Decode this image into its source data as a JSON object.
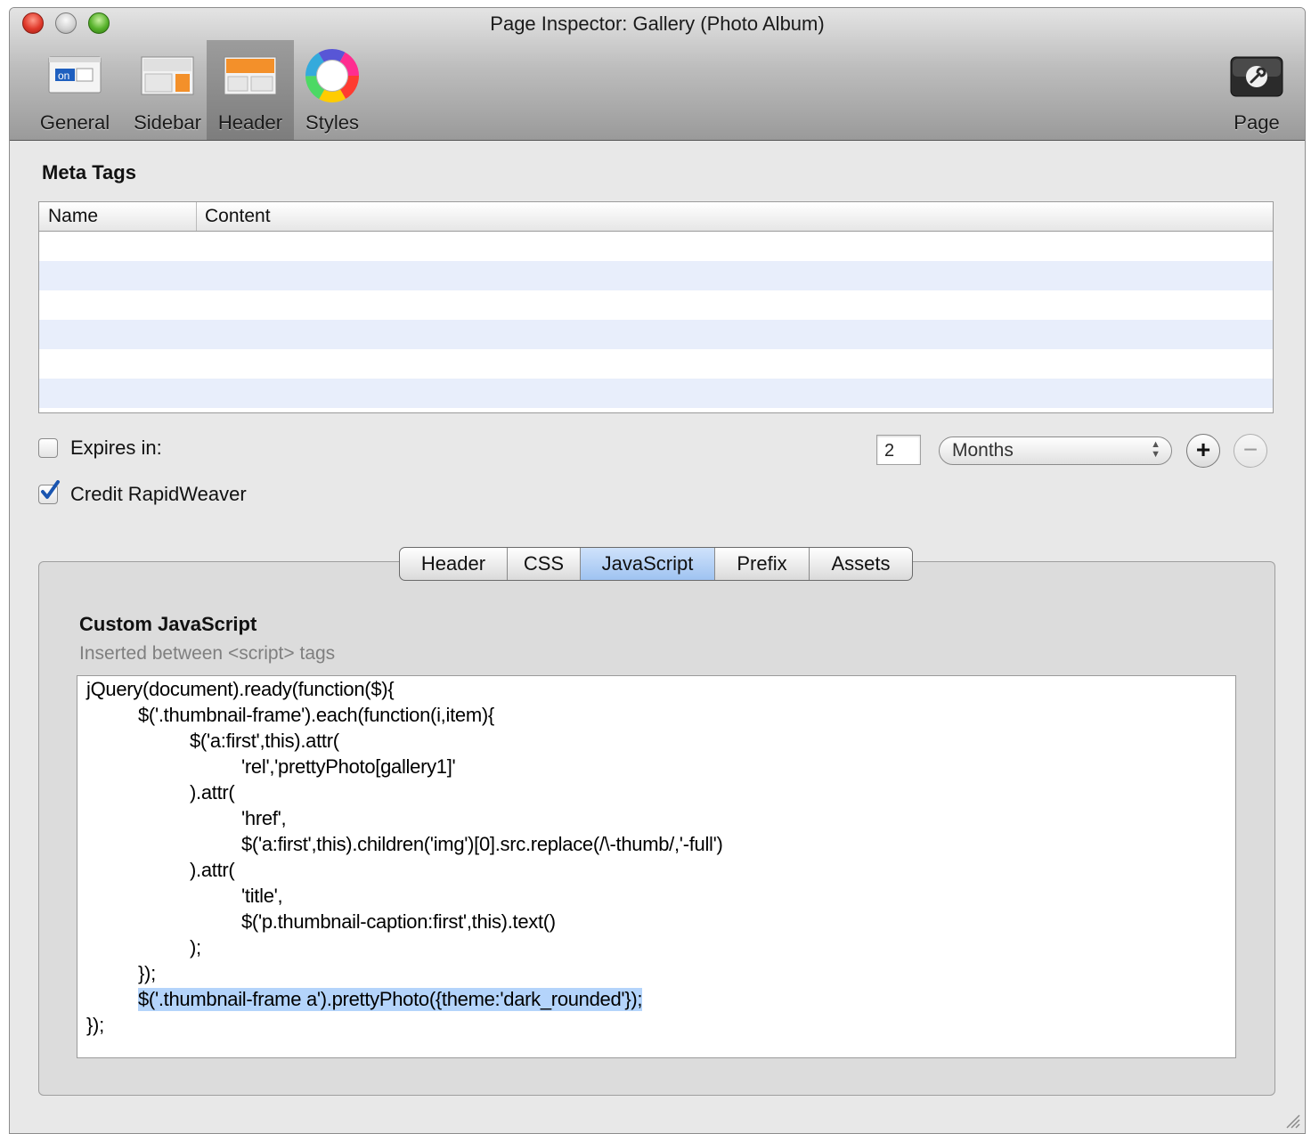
{
  "window": {
    "title": "Page Inspector: Gallery (Photo Album)"
  },
  "toolbar": {
    "items": [
      {
        "label": "General",
        "icon": "general-icon"
      },
      {
        "label": "Sidebar",
        "icon": "sidebar-icon"
      },
      {
        "label": "Header",
        "icon": "header-icon",
        "selected": true
      },
      {
        "label": "Styles",
        "icon": "color-wheel-icon"
      }
    ],
    "page": {
      "label": "Page",
      "icon": "wrench-icon"
    },
    "general_icon_text": "on"
  },
  "meta_tags": {
    "title": "Meta Tags",
    "columns": [
      "Name",
      "Content"
    ],
    "rows": []
  },
  "expires": {
    "label": "Expires in:",
    "checked": false,
    "value": "2",
    "unit": "Months"
  },
  "credit": {
    "label": "Credit RapidWeaver",
    "checked": true
  },
  "tabs": {
    "items": [
      "Header",
      "CSS",
      "JavaScript",
      "Prefix",
      "Assets"
    ],
    "active": "JavaScript"
  },
  "custom_js": {
    "title": "Custom JavaScript",
    "subtitle": "Inserted between <script> tags",
    "lines": [
      "jQuery(document).ready(function($){",
      "$('.thumbnail-frame').each(function(i,item){",
      "$('a:first',this).attr(",
      "'rel','prettyPhoto[gallery1]'",
      ").attr(",
      "'href',",
      "$('a:first',this).children('img')[0].src.replace(/\\-thumb/,'-full')",
      ").attr(",
      "'title',",
      "$('p.thumbnail-caption:first',this).text()",
      ");",
      "});",
      "$('.thumbnail-frame a').prettyPhoto({theme:'dark_rounded'});",
      "});"
    ],
    "highlighted_line": 12
  },
  "colors": {
    "selection": "#b4d4fb",
    "active_tab": "#9fc3f1",
    "row_alt": "#e8eefb"
  }
}
